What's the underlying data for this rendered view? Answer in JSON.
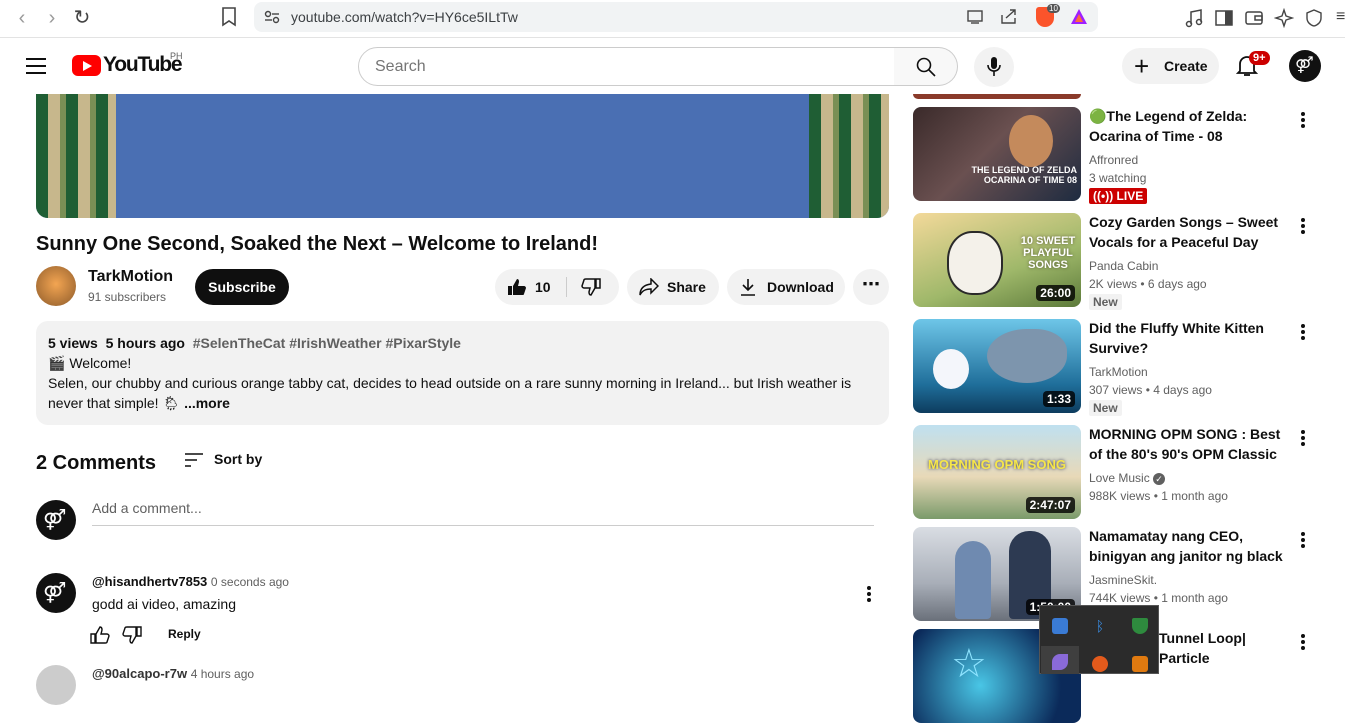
{
  "browser": {
    "url": "youtube.com/watch?v=HY6ce5ILtTw",
    "ext_badge": "10"
  },
  "header": {
    "logo": "YouTube",
    "country": "PH",
    "search_placeholder": "Search",
    "create_label": "Create",
    "notif_count": "9+"
  },
  "video": {
    "title": "Sunny One Second, Soaked the Next – Welcome to Ireland!",
    "channel": "TarkMotion",
    "subscribers": "91 subscribers",
    "subscribe_label": "Subscribe",
    "likes": "10",
    "share_label": "Share",
    "download_label": "Download",
    "views": "5 views",
    "time": "5 hours ago",
    "tags": "#SelenTheCat #IrishWeather #PixarStyle",
    "desc_line1": "🎬 Welcome!",
    "desc_line2": "Selen, our chubby and curious orange tabby cat, decides to head outside on a rare sunny morning in Ireland... but Irish weather is",
    "desc_line3": "never that simple! 🌦",
    "more": "...more"
  },
  "comments": {
    "count_label": "2 Comments",
    "sort_label": "Sort by",
    "add_placeholder": "Add a comment...",
    "items": [
      {
        "user": "@hisandhertv7853",
        "time": "0 seconds ago",
        "text": "godd ai video, amazing",
        "reply": "Reply"
      }
    ],
    "partial_user": "@90alcapo-r7w",
    "partial_time": "4 hours ago"
  },
  "related": [
    {
      "title": "🟢The Legend of Zelda: Ocarina of Time - 08",
      "channel": "Affronred",
      "meta": "3 watching",
      "badge": "LIVE",
      "thumb_text": "THE LEGEND OF ZELDA OCARINA OF TIME 08"
    },
    {
      "title": "Cozy Garden Songs – Sweet Vocals for a Peaceful Day",
      "channel": "Panda Cabin",
      "meta": "2K views • 6 days ago",
      "badge": "New",
      "duration": "26:00",
      "thumb_text": "10 SWEET PLAYFUL SONGS"
    },
    {
      "title": "Did the Fluffy White Kitten Survive?",
      "channel": "TarkMotion",
      "meta": "307 views • 4 days ago",
      "badge": "New",
      "duration": "1:33"
    },
    {
      "title": "MORNING OPM SONG : Best of the 80's 90's OPM Classic Lov...",
      "channel": "Love Music",
      "meta": "988K views • 1 month ago",
      "duration": "2:47:07",
      "thumb_text": "MORNING OPM SONG"
    },
    {
      "title": "Namamatay nang CEO, binigyan ang janitor ng black card, pero...",
      "channel": "JasmineSkit.",
      "meta": "744K views • 1 month ago",
      "duration": "1:50:00"
    },
    {
      "title": "Tunnel Loop| Particle",
      "channel": "",
      "meta": ""
    }
  ],
  "colors": {
    "brand_red": "#ff0000",
    "live_red": "#cc0000",
    "verified": "#606060"
  }
}
